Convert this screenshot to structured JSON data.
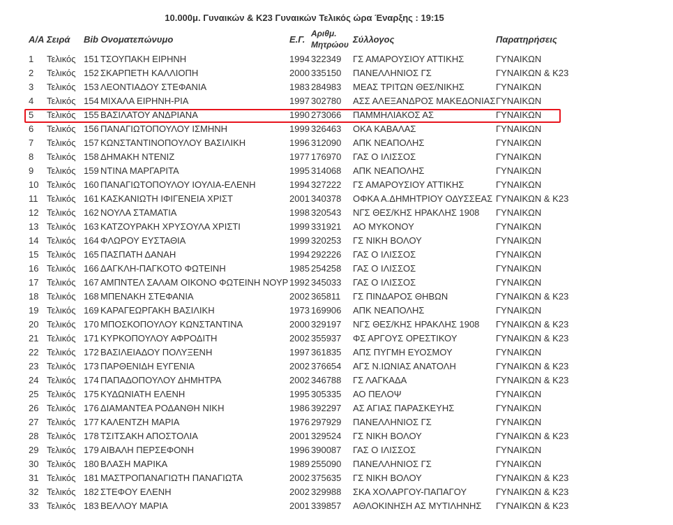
{
  "page": {
    "title": "10.000μ. Γυναικών & K23 Γυναικών Τελικός ώρα Έναρξης : 19:15"
  },
  "table": {
    "headers": {
      "aa": "Α/Α",
      "seira": "Σειρά",
      "bib_name": "Bib Ονοματεπώνυμο",
      "eg": "Ε.Γ.",
      "arith_line1": "Αριθμ.",
      "arith_line2": "Μητρώου",
      "syllogos": "Σύλλογος",
      "paratiriseis": "Παρατηρήσεις"
    },
    "highlighted_row_index": 4,
    "highlight_color": "#e8141c",
    "rows": [
      {
        "aa": "1",
        "seira": "Τελικός",
        "bib": "151",
        "name": "ΤΣΟΥΠΑΚΗ ΕΙΡΗΝΗ",
        "eg": "1994",
        "arith": "322349",
        "syllogos": "ΓΣ ΑΜΑΡΟΥΣΙΟΥ ΑΤΤΙΚΗΣ",
        "notes": "ΓΥΝΑΙΚΩΝ"
      },
      {
        "aa": "2",
        "seira": "Τελικός",
        "bib": "152",
        "name": "ΣΚΑΡΠΕΤΗ ΚΑΛΛΙΟΠΗ",
        "eg": "2000",
        "arith": "335150",
        "syllogos": "ΠΑΝΕΛΛΗΝΙΟΣ ΓΣ",
        "notes": "ΓΥΝΑΙΚΩΝ & K23"
      },
      {
        "aa": "3",
        "seira": "Τελικός",
        "bib": "153",
        "name": "ΛΕΟΝΤΙΑΔΟΥ ΣΤΕΦΑΝΙΑ",
        "eg": "1983",
        "arith": "284983",
        "syllogos": "ΜΕΑΣ ΤΡΙΤΩΝ ΘΕΣ/ΝΙΚΗΣ",
        "notes": "ΓΥΝΑΙΚΩΝ"
      },
      {
        "aa": "4",
        "seira": "Τελικός",
        "bib": "154",
        "name": "ΜΙΧΑΛΑ ΕΙΡΗΝΗ-ΡΙΑ",
        "eg": "1997",
        "arith": "302780",
        "syllogos": "ΑΣΣ ΑΛΕΞΑΝΔΡΟΣ ΜΑΚΕΔΟΝΙΑΣ",
        "notes": "ΓΥΝΑΙΚΩΝ"
      },
      {
        "aa": "5",
        "seira": "Τελικός",
        "bib": "155",
        "name": "ΒΑΣΙΛΑΤΟΥ ΑΝΔΡΙΑΝΑ",
        "eg": "1990",
        "arith": "273066",
        "syllogos": "ΠΑΜΜΗΛΙΑΚΟΣ ΑΣ",
        "notes": "ΓΥΝΑΙΚΩΝ"
      },
      {
        "aa": "6",
        "seira": "Τελικός",
        "bib": "156",
        "name": "ΠΑΝΑΓΙΩΤΟΠΟΥΛΟΥ ΙΣΜΗΝΗ",
        "eg": "1999",
        "arith": "326463",
        "syllogos": "ΟΚΑ ΚΑΒΑΛΑΣ",
        "notes": "ΓΥΝΑΙΚΩΝ"
      },
      {
        "aa": "7",
        "seira": "Τελικός",
        "bib": "157",
        "name": "ΚΩΝΣΤΑΝΤΙΝΟΠΟΥΛΟΥ ΒΑΣΙΛΙΚΗ",
        "eg": "1996",
        "arith": "312090",
        "syllogos": "ΑΠΚ ΝΕΑΠΟΛΗΣ",
        "notes": "ΓΥΝΑΙΚΩΝ"
      },
      {
        "aa": "8",
        "seira": "Τελικός",
        "bib": "158",
        "name": "ΔΗΜΑΚΗ ΝΤΕΝΙΖ",
        "eg": "1977",
        "arith": "176970",
        "syllogos": "ΓΑΣ Ο ΙΛΙΣΣΟΣ",
        "notes": "ΓΥΝΑΙΚΩΝ"
      },
      {
        "aa": "9",
        "seira": "Τελικός",
        "bib": "159",
        "name": "ΝΤΙΝΑ ΜΑΡΓΑΡΙΤΑ",
        "eg": "1995",
        "arith": "314068",
        "syllogos": "ΑΠΚ ΝΕΑΠΟΛΗΣ",
        "notes": "ΓΥΝΑΙΚΩΝ"
      },
      {
        "aa": "10",
        "seira": "Τελικός",
        "bib": "160",
        "name": "ΠΑΝΑΓΙΩΤΟΠΟΥΛΟΥ ΙΟΥΛΙΑ-ΕΛΕΝΗ",
        "eg": "1994",
        "arith": "327222",
        "syllogos": "ΓΣ ΑΜΑΡΟΥΣΙΟΥ ΑΤΤΙΚΗΣ",
        "notes": "ΓΥΝΑΙΚΩΝ"
      },
      {
        "aa": "11",
        "seira": "Τελικός",
        "bib": "161",
        "name": "ΚΑΣΚΑΝΙΩΤΗ ΙΦΙΓΕΝΕΙΑ ΧΡΙΣΤ",
        "eg": "2001",
        "arith": "340378",
        "syllogos": "ΟΦΚΑ Α.ΔΗΜΗΤΡΙΟΥ ΟΔΥΣΣΕΑΣ",
        "notes": "ΓΥΝΑΙΚΩΝ & K23"
      },
      {
        "aa": "12",
        "seira": "Τελικός",
        "bib": "162",
        "name": "ΝΟΥΛΑ ΣΤΑΜΑΤΙΑ",
        "eg": "1998",
        "arith": "320543",
        "syllogos": "ΝΓΣ ΘΕΣ/ΚΗΣ ΗΡΑΚΛΗΣ 1908",
        "notes": "ΓΥΝΑΙΚΩΝ"
      },
      {
        "aa": "13",
        "seira": "Τελικός",
        "bib": "163",
        "name": "ΚΑΤΖΟΥΡΑΚΗ ΧΡΥΣΟΥΛΑ ΧΡΙΣΤΙ",
        "eg": "1999",
        "arith": "331921",
        "syllogos": "ΑΟ ΜΥΚΟΝΟΥ",
        "notes": "ΓΥΝΑΙΚΩΝ"
      },
      {
        "aa": "14",
        "seira": "Τελικός",
        "bib": "164",
        "name": "ΦΛΩΡΟΥ ΕΥΣΤΑΘΙΑ",
        "eg": "1999",
        "arith": "320253",
        "syllogos": "ΓΣ ΝΙΚΗ ΒΟΛΟΥ",
        "notes": "ΓΥΝΑΙΚΩΝ"
      },
      {
        "aa": "15",
        "seira": "Τελικός",
        "bib": "165",
        "name": "ΠΑΣΠΑΤΗ ΔΑΝΑΗ",
        "eg": "1994",
        "arith": "292226",
        "syllogos": "ΓΑΣ Ο ΙΛΙΣΣΟΣ",
        "notes": "ΓΥΝΑΙΚΩΝ"
      },
      {
        "aa": "16",
        "seira": "Τελικός",
        "bib": "166",
        "name": "ΔΑΓΚΛΗ-ΠΑΓΚΟΤΟ ΦΩΤΕΙΝΗ",
        "eg": "1985",
        "arith": "254258",
        "syllogos": "ΓΑΣ Ο ΙΛΙΣΣΟΣ",
        "notes": "ΓΥΝΑΙΚΩΝ"
      },
      {
        "aa": "17",
        "seira": "Τελικός",
        "bib": "167",
        "name": "ΑΜΠΝΤΕΛ ΣΑΛΑΜ ΟΙΚΟΝΟ ΦΩΤΕΙΝΗ ΝΟΥΡ",
        "eg": "1992",
        "arith": "345033",
        "syllogos": "ΓΑΣ Ο ΙΛΙΣΣΟΣ",
        "notes": "ΓΥΝΑΙΚΩΝ"
      },
      {
        "aa": "18",
        "seira": "Τελικός",
        "bib": "168",
        "name": "ΜΠΕΝΑΚΗ ΣΤΕΦΑΝΙΑ",
        "eg": "2002",
        "arith": "365811",
        "syllogos": "ΓΣ ΠΙΝΔΑΡΟΣ ΘΗΒΩΝ",
        "notes": "ΓΥΝΑΙΚΩΝ & K23"
      },
      {
        "aa": "19",
        "seira": "Τελικός",
        "bib": "169",
        "name": "ΚΑΡΑΓΕΩΡΓΑΚΗ ΒΑΣΙΛΙΚΗ",
        "eg": "1973",
        "arith": "169906",
        "syllogos": "ΑΠΚ ΝΕΑΠΟΛΗΣ",
        "notes": "ΓΥΝΑΙΚΩΝ"
      },
      {
        "aa": "20",
        "seira": "Τελικός",
        "bib": "170",
        "name": "ΜΠΟΣΚΟΠΟΥΛΟΥ ΚΩΝΣΤΑΝΤΙΝΑ",
        "eg": "2000",
        "arith": "329197",
        "syllogos": "ΝΓΣ ΘΕΣ/ΚΗΣ ΗΡΑΚΛΗΣ 1908",
        "notes": "ΓΥΝΑΙΚΩΝ & K23"
      },
      {
        "aa": "21",
        "seira": "Τελικός",
        "bib": "171",
        "name": "ΚΥΡΚΟΠΟΥΛΟΥ ΑΦΡΟΔΙΤΗ",
        "eg": "2002",
        "arith": "355937",
        "syllogos": "ΦΣ ΑΡΓΟΥΣ ΟΡΕΣΤΙΚΟΥ",
        "notes": "ΓΥΝΑΙΚΩΝ & K23"
      },
      {
        "aa": "22",
        "seira": "Τελικός",
        "bib": "172",
        "name": "ΒΑΣΙΛΕΙΑΔΟΥ ΠΟΛΥΞΕΝΗ",
        "eg": "1997",
        "arith": "361835",
        "syllogos": "ΑΠΣ ΠΥΓΜΗ ΕΥΟΣΜΟΥ",
        "notes": "ΓΥΝΑΙΚΩΝ"
      },
      {
        "aa": "23",
        "seira": "Τελικός",
        "bib": "173",
        "name": "ΠΑΡΘΕΝΙΔΗ ΕΥΓΕΝΙΑ",
        "eg": "2002",
        "arith": "376654",
        "syllogos": "ΑΓΣ Ν.ΙΩΝΙΑΣ ΑΝΑΤΟΛΗ",
        "notes": "ΓΥΝΑΙΚΩΝ & K23"
      },
      {
        "aa": "24",
        "seira": "Τελικός",
        "bib": "174",
        "name": "ΠΑΠΑΔΟΠΟΥΛΟΥ ΔΗΜΗΤΡΑ",
        "eg": "2002",
        "arith": "346788",
        "syllogos": "ΓΣ ΛΑΓΚΑΔΑ",
        "notes": "ΓΥΝΑΙΚΩΝ & K23"
      },
      {
        "aa": "25",
        "seira": "Τελικός",
        "bib": "175",
        "name": "ΚΥΔΩΝΙΑΤΗ ΕΛΕΝΗ",
        "eg": "1995",
        "arith": "305335",
        "syllogos": "ΑΟ ΠΕΛΟΨ",
        "notes": "ΓΥΝΑΙΚΩΝ"
      },
      {
        "aa": "26",
        "seira": "Τελικός",
        "bib": "176",
        "name": "ΔΙΑΜΑΝΤΕΑ ΡΟΔΑΝΘΗ ΝΙΚΗ",
        "eg": "1986",
        "arith": "392297",
        "syllogos": "ΑΣ ΑΓΙΑΣ ΠΑΡΑΣΚΕΥΗΣ",
        "notes": "ΓΥΝΑΙΚΩΝ"
      },
      {
        "aa": "27",
        "seira": "Τελικός",
        "bib": "177",
        "name": "ΚΑΛΕΝΤΖΗ ΜΑΡΙΑ",
        "eg": "1976",
        "arith": "297929",
        "syllogos": "ΠΑΝΕΛΛΗΝΙΟΣ ΓΣ",
        "notes": "ΓΥΝΑΙΚΩΝ"
      },
      {
        "aa": "28",
        "seira": "Τελικός",
        "bib": "178",
        "name": "ΤΣΙΤΣΑΚΗ ΑΠΟΣΤΟΛΙΑ",
        "eg": "2001",
        "arith": "329524",
        "syllogos": "ΓΣ ΝΙΚΗ ΒΟΛΟΥ",
        "notes": "ΓΥΝΑΙΚΩΝ & K23"
      },
      {
        "aa": "29",
        "seira": "Τελικός",
        "bib": "179",
        "name": "ΑΙΒΑΛΗ ΠΕΡΣΕΦΟΝΗ",
        "eg": "1996",
        "arith": "390087",
        "syllogos": "ΓΑΣ Ο ΙΛΙΣΣΟΣ",
        "notes": "ΓΥΝΑΙΚΩΝ"
      },
      {
        "aa": "30",
        "seira": "Τελικός",
        "bib": "180",
        "name": "ΒΛΑΣΗ ΜΑΡΙΚΑ",
        "eg": "1989",
        "arith": "255090",
        "syllogos": "ΠΑΝΕΛΛΗΝΙΟΣ ΓΣ",
        "notes": "ΓΥΝΑΙΚΩΝ"
      },
      {
        "aa": "31",
        "seira": "Τελικός",
        "bib": "181",
        "name": "ΜΑΣΤΡΟΠΑΝΑΓΙΩΤΗ ΠΑΝΑΓΙΩΤΑ",
        "eg": "2002",
        "arith": "375635",
        "syllogos": "ΓΣ ΝΙΚΗ ΒΟΛΟΥ",
        "notes": "ΓΥΝΑΙΚΩΝ & K23"
      },
      {
        "aa": "32",
        "seira": "Τελικός",
        "bib": "182",
        "name": "ΣΤΕΦΟΥ ΕΛΕΝΗ",
        "eg": "2002",
        "arith": "329988",
        "syllogos": "ΣΚΑ ΧΟΛΑΡΓΟΥ-ΠΑΠΑΓΟΥ",
        "notes": "ΓΥΝΑΙΚΩΝ & K23"
      },
      {
        "aa": "33",
        "seira": "Τελικός",
        "bib": "183",
        "name": "ΒΕΛΛΟΥ ΜΑΡΙΑ",
        "eg": "2001",
        "arith": "339857",
        "syllogos": "ΑΘΛΟΚΙΝΗΣΗ ΑΣ ΜΥΤΙΛΗΝΗΣ",
        "notes": "ΓΥΝΑΙΚΩΝ & K23"
      }
    ]
  }
}
